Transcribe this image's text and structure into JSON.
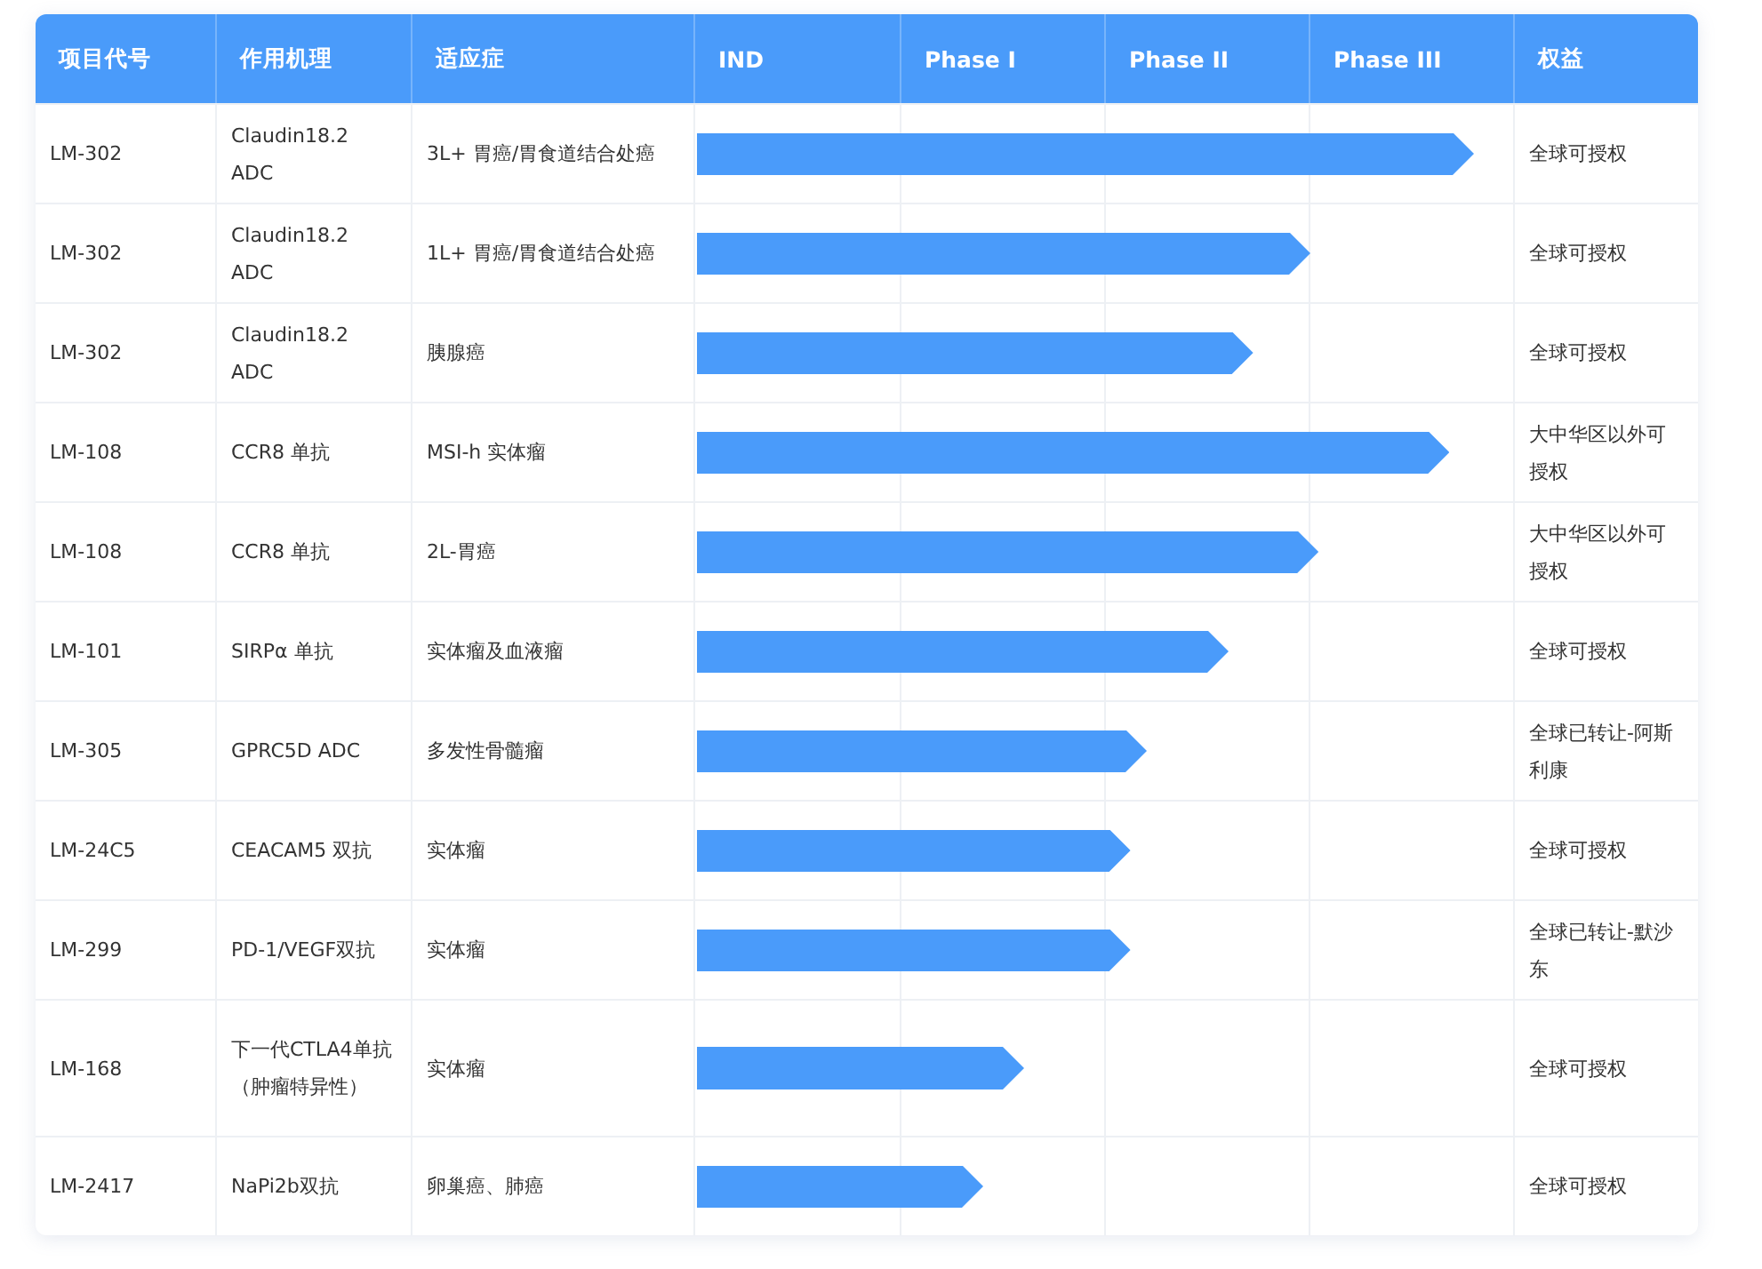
{
  "table": {
    "columns": [
      "项目代号",
      "作用机理",
      "适应症",
      "IND",
      "Phase I",
      "Phase II",
      "Phase III",
      "权益"
    ],
    "rows": [
      {
        "code": "LM-302",
        "mechanism": "Claudin18.2 ADC",
        "indication": "3L+ 胃癌/胃食道结合处癌",
        "level": 0.95,
        "rights": "全球可授权"
      },
      {
        "code": "LM-302",
        "mechanism": "Claudin18.2 ADC",
        "indication": "1L+ 胃癌/胃食道结合处癌",
        "level": 0.75,
        "rights": "全球可授权"
      },
      {
        "code": "LM-302",
        "mechanism": "Claudin18.2 ADC",
        "indication": "胰腺癌",
        "level": 0.68,
        "rights": "全球可授权"
      },
      {
        "code": "LM-108",
        "mechanism": "CCR8 单抗",
        "indication": "MSI-h 实体瘤",
        "level": 0.92,
        "rights": "大中华区以外可授权"
      },
      {
        "code": "LM-108",
        "mechanism": "CCR8 单抗",
        "indication": "2L-胃癌",
        "level": 0.76,
        "rights": "大中华区以外可授权"
      },
      {
        "code": "LM-101",
        "mechanism": "SIRPα 单抗",
        "indication": "实体瘤及血液瘤",
        "level": 0.65,
        "rights": "全球可授权"
      },
      {
        "code": "LM-305",
        "mechanism": "GPRC5D ADC",
        "indication": "多发性骨髓瘤",
        "level": 0.55,
        "rights": "全球已转让-阿斯利康"
      },
      {
        "code": "LM-24C5",
        "mechanism": "CEACAM5 双抗",
        "indication": "实体瘤",
        "level": 0.53,
        "rights": "全球可授权"
      },
      {
        "code": "LM-299",
        "mechanism": "PD-1/VEGF双抗",
        "indication": "实体瘤",
        "level": 0.53,
        "rights": "全球已转让-默沙东"
      },
      {
        "code": "LM-168",
        "mechanism": "下一代CTLA4单抗（肿瘤特异性）",
        "indication": "实体瘤",
        "level": 0.4,
        "rights": "全球可授权"
      },
      {
        "code": "LM-2417",
        "mechanism": "NaPi2b双抗",
        "indication": "卵巢癌、肺癌",
        "level": 0.35,
        "rights": "全球可授权"
      }
    ]
  }
}
